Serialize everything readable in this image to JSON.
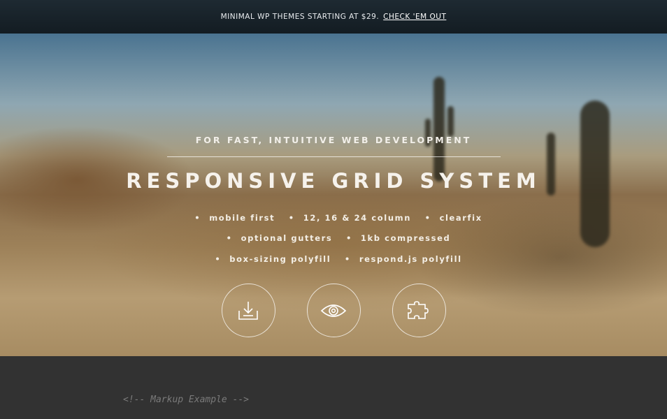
{
  "topbar": {
    "text": "MINIMAL WP THEMES STARTING AT $29.",
    "link": "CHECK 'EM OUT"
  },
  "hero": {
    "tagline": "FOR FAST, INTUITIVE WEB DEVELOPMENT",
    "title": "RESPONSIVE GRID SYSTEM",
    "features_row1": [
      "mobile first",
      "12, 16 & 24 column",
      "clearfix"
    ],
    "features_row2": [
      "optional gutters",
      "1kb compressed"
    ],
    "features_row3": [
      "box-sizing polyfill",
      "respond.js polyfill"
    ],
    "icons": [
      "download-icon",
      "eye-icon",
      "puzzle-icon"
    ]
  },
  "code": {
    "comment": "<!-- Markup Example -->"
  }
}
